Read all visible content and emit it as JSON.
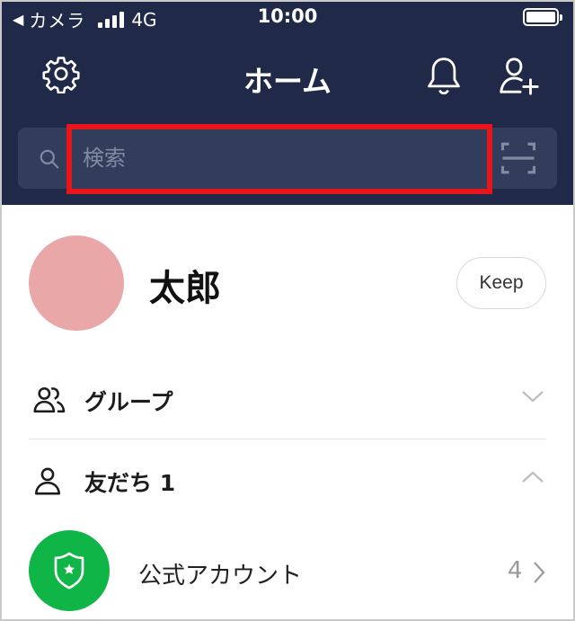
{
  "status_bar": {
    "back_app": "カメラ",
    "network": "4G",
    "time": "10:00"
  },
  "header": {
    "title": "ホーム",
    "left_icon": "gear-icon",
    "right_icons": [
      "bell-icon",
      "add-friend-icon"
    ]
  },
  "search": {
    "placeholder": "検索",
    "value": "",
    "highlight_color": "#e8141b"
  },
  "profile": {
    "name": "太郎",
    "keep_label": "Keep",
    "avatar_color": "#e9a7a8"
  },
  "sections": [
    {
      "label": "グループ",
      "icon": "group-icon",
      "state": "collapsed"
    },
    {
      "label": "友だち 1",
      "icon": "person-icon",
      "state": "expanded"
    }
  ],
  "official_account": {
    "label": "公式アカウント",
    "count": "4",
    "icon": "shield-star-icon",
    "color": "#10b548"
  },
  "colors": {
    "header_bg": "#202a48",
    "search_bg": "#323d5c"
  }
}
